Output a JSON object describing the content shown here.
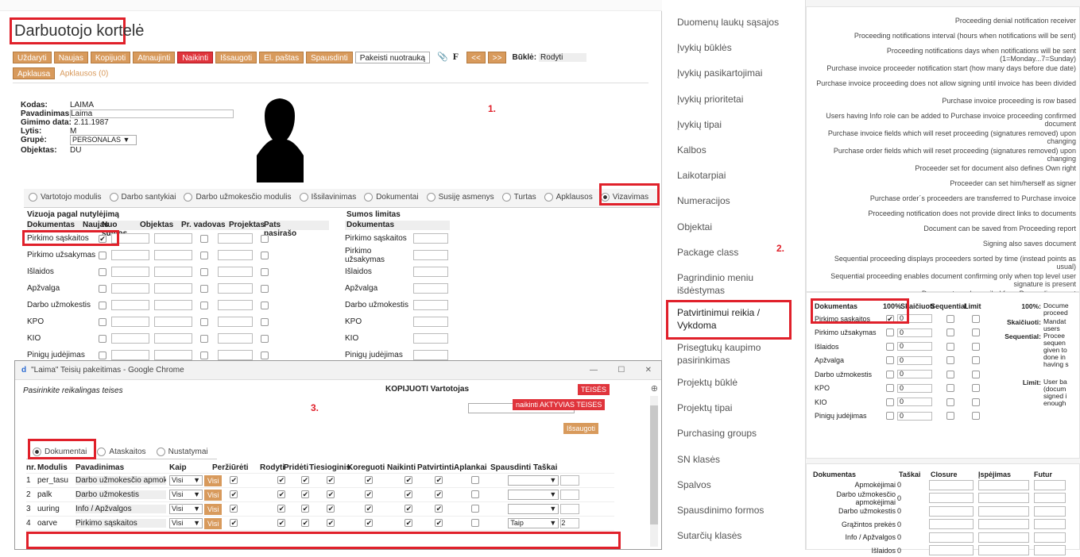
{
  "left": {
    "title": "Darbuotojo kortelė",
    "toolbar": [
      "Uždaryti",
      "Naujas",
      "Kopijuoti",
      "Atnaujinti",
      "Naikinti",
      "Išsaugoti",
      "El. paštas",
      "Spausdinti",
      "Pakeisti nuotrauką",
      "<<",
      ">>"
    ],
    "state_label": "Būklė:",
    "state_value": "Rodyti",
    "toolbar2": [
      "Apklausa",
      "Apklausos (0)"
    ],
    "fields": [
      {
        "label": "Kodas:",
        "value": "LAIMA"
      },
      {
        "label": "Pavadinimas:",
        "value": "Laima"
      },
      {
        "label": "Gimimo data:",
        "value": "2.11.1987"
      },
      {
        "label": "Lytis:",
        "value": "M"
      },
      {
        "label": "Grupė:",
        "value": "PERSONALAS"
      },
      {
        "label": "Objektas:",
        "value": "DU"
      }
    ],
    "marker1": "1.",
    "tabs": [
      "Vartotojo modulis",
      "Darbo santykiai",
      "Darbo užmokesčio modulis",
      "Išsilavinimas",
      "Dokumentai",
      "Susiję asmenys",
      "Turtas",
      "Apklausos",
      "Vizavimas"
    ],
    "section_title": "Vizuoja pagal nutylėjimą",
    "cols": [
      "Dokumentas",
      "Naujas",
      "Nuo sumos",
      "Objektas",
      "Pr. vadovas",
      "Projektas",
      "Pats pasirašo"
    ],
    "docs": [
      "Pirkimo sąskaitos",
      "Pirkimo užsakymas",
      "Išlaidos",
      "Apžvalga",
      "Darbo užmokestis",
      "KPO",
      "KIO",
      "Pinigų judėjimas"
    ],
    "limit_title": "Sumos limitas",
    "limit_col": "Dokumentas"
  },
  "popup": {
    "title": "\"Laima\" Teisių pakeitimas - Google Chrome",
    "hint": "Pasirinkite reikalingas teises",
    "copy_label": "KOPIJUOTI Vartotojas",
    "teises_btn": "TEISĖS",
    "naikinti_btn": "naikinti AKTYVIAS TEISES",
    "save_btn": "Išsaugoti",
    "marker3": "3.",
    "tabs": [
      "Dokumentai",
      "Ataskaitos",
      "Nustatymai"
    ],
    "headers": [
      "nr.",
      "Modulis",
      "Pavadinimas",
      "Kaip",
      "Peržiūrėti",
      "Rodyti",
      "Pridėti",
      "Tiesioginis",
      "Koreguoti",
      "Naikinti",
      "Patvirtinti",
      "Aplankai",
      "Spausdinti",
      "Taškai"
    ],
    "rows": [
      {
        "nr": "1",
        "modulis": "per_tasu",
        "pav": "Darbo užmokesčio apmokėjimai",
        "kaip": "Visi",
        "btn": "Visi",
        "spaus": "",
        "taskai": ""
      },
      {
        "nr": "2",
        "modulis": "palk",
        "pav": "Darbo užmokestis",
        "kaip": "Visi",
        "btn": "Visi",
        "spaus": "",
        "taskai": ""
      },
      {
        "nr": "3",
        "modulis": "uuring",
        "pav": "Info / Apžvalgos",
        "kaip": "Visi",
        "btn": "Visi",
        "spaus": "",
        "taskai": ""
      },
      {
        "nr": "4",
        "modulis": "oarve",
        "pav": "Pirkimo sąskaitos",
        "kaip": "Visi",
        "btn": "Visi",
        "spaus": "Taip",
        "taskai": "2"
      }
    ]
  },
  "menu": {
    "items": [
      "Duomenų laukų sąsajos",
      "Įvykių būklės",
      "Įvykių pasikartojimai",
      "Įvykių prioritetai",
      "Įvykių tipai",
      "Kalbos",
      "Laikotarpiai",
      "Numeracijos",
      "Objektai",
      "Package class",
      "Pagrindinio meniu išdėstymas",
      "Patvirtinimui reikia / Vykdoma",
      "Prisegtukų kaupimo pasirinkimas",
      "Projektų būklė",
      "Projektų tipai",
      "Purchasing groups",
      "SN klasės",
      "Spalvos",
      "Spausdinimo formos",
      "Sutarčių klasės"
    ],
    "marker2": "2."
  },
  "right": {
    "lines": [
      "Proceeding denial notification receiver",
      "Proceeding notifications interval (hours when notifications will be sent)",
      "Proceeding notifications days when notifications will be sent (1=Monday...7=Sunday)",
      "Purchase invoice proceeder notification start (how many days before due date)",
      "Purchase invoice proceeding does not allow signing until invoice has been divided",
      "Purchase invoice proceeding is row based",
      "Users having Info role can be added to Purchase invoice proceeding confirmed document",
      "Purchase invoice fields which will reset proceeding (signatures removed) upon changing",
      "Purchase order fields which will reset proceeding (signatures removed) upon changing",
      "Proceeder set for document also defines Own right",
      "Proceeder can set him/herself as signer",
      "Purchase order´s proceeders are transferred to Purchase invoice",
      "Proceeding notification does not provide direct links to documents",
      "Document can be saved from Proceeding report",
      "Signing also saves document",
      "Sequential proceeding displays proceeders sorted by time (instead points as usual)",
      "Sequential proceeding enables document confirming only when top level user signature is present",
      "Document can be mailed from Proceeding report"
    ],
    "table_headers": [
      "Dokumentas",
      "100%",
      "Skaičiuoti",
      "Sequential",
      "Limit"
    ],
    "docs": [
      "Pirkimo sąskaitos",
      "Pirkimo užsakymas",
      "Išlaidos",
      "Apžvalga",
      "Darbo užmokestis",
      "KPO",
      "KIO",
      "Pinigų judėjimas"
    ],
    "zero": "0",
    "legend": [
      {
        "k": "100%:",
        "v": "Docume proceed"
      },
      {
        "k": "Skaičiuoti:",
        "v": "Mandat users"
      },
      {
        "k": "Sequential:",
        "v": "Procee sequen given to done in having s"
      },
      {
        "k": "Limit:",
        "v": "User ba (docum signed i enough"
      }
    ],
    "bottom_headers": [
      "Dokumentas",
      "Taškai",
      "Closure",
      "Įspėjimas",
      "Futur"
    ],
    "bottom_rows": [
      "Apmokėjimai",
      "Darbo užmokesčio apmokėjimai",
      "Darbo užmokestis",
      "Grąžintos prekės",
      "Info / Apžvalgos",
      "Išlaidos"
    ]
  }
}
